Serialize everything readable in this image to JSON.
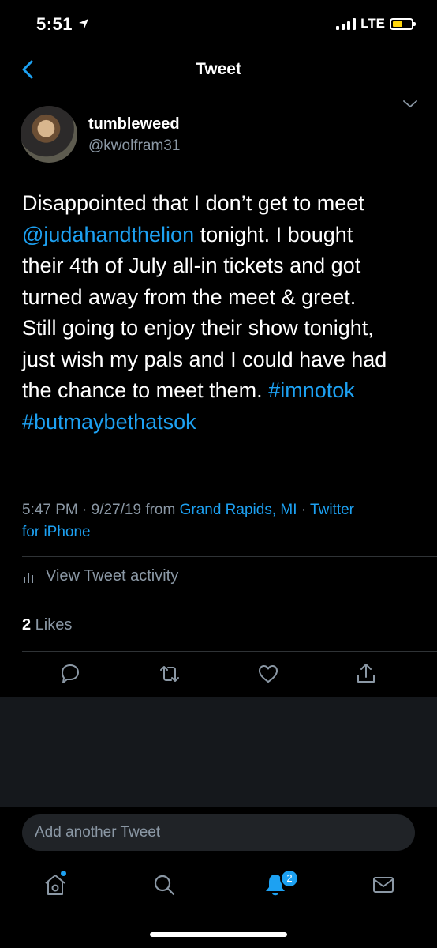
{
  "status": {
    "time": "5:51",
    "network": "LTE"
  },
  "nav": {
    "title": "Tweet"
  },
  "author": {
    "name": "tumbleweed",
    "handle": "@kwolfram31"
  },
  "tweet": {
    "line1": "Disappointed that I don’t get to meet",
    "mention": "@judahandthelion",
    "line2_rest": " tonight. I bought",
    "line3": "their 4th of July all-in tickets and got",
    "line4": "turned away from the meet & greet.",
    "line5": "Still going to enjoy their show tonight,",
    "line6": "just wish my pals and I could have had",
    "line7_start": "the chance to meet them. ",
    "hashtag1": "#imnotok",
    "hashtag2": "#butmaybethatsok"
  },
  "meta": {
    "time_date": "5:47 PM · 9/27/19 from ",
    "location": "Grand Rapids, MI",
    "sep": " · ",
    "source_line1": "Twitter",
    "source_line2": "for iPhone"
  },
  "activity_label": "View Tweet activity",
  "likes": {
    "count": "2",
    "label": " Likes"
  },
  "compose_placeholder": "Add another Tweet",
  "tabs": {
    "notifications_badge": "2"
  },
  "colors": {
    "accent": "#1da1f2",
    "muted": "#8b98a5",
    "background": "#000000"
  }
}
